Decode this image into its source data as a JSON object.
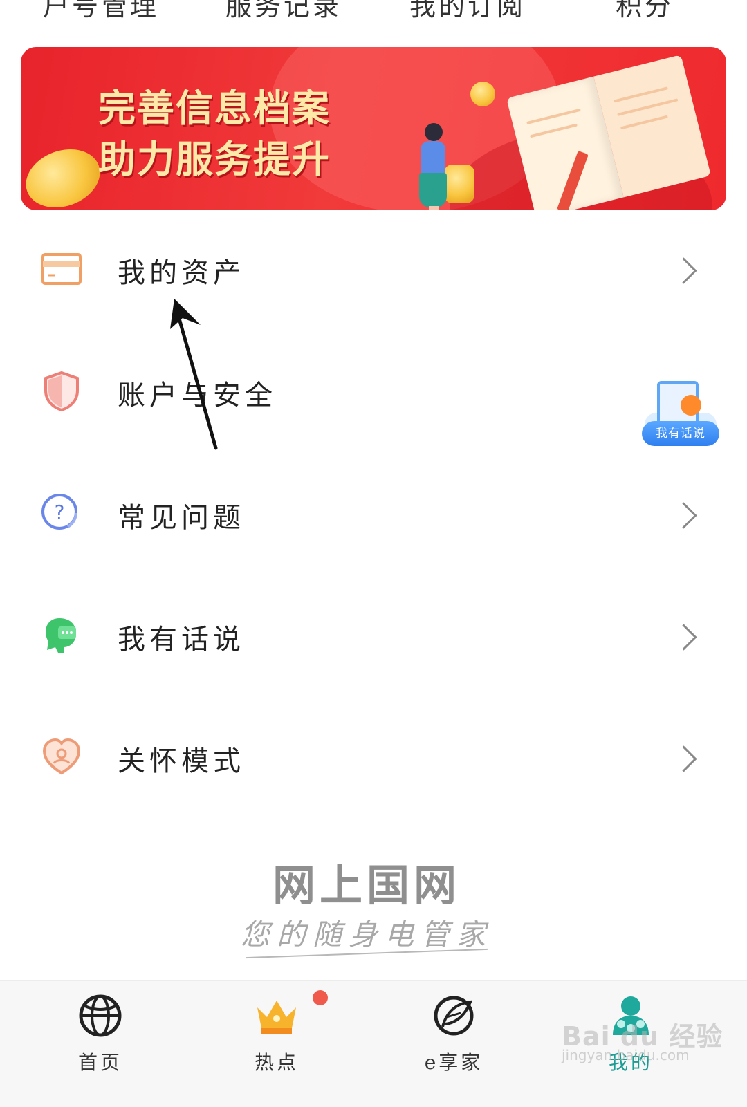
{
  "top_tabs": [
    "户号管理",
    "服务记录",
    "我的订阅",
    "积分"
  ],
  "banner": {
    "line1": "完善信息档案",
    "line2": "助力服务提升",
    "colors": {
      "background": "#ea2a2e",
      "text": "#ffe9a8"
    }
  },
  "menu": {
    "items": [
      {
        "label": "我的资产",
        "icon": "card-icon"
      },
      {
        "label": "账户与安全",
        "icon": "shield-icon"
      },
      {
        "label": "常见问题",
        "icon": "question-icon"
      },
      {
        "label": "我有话说",
        "icon": "chat-icon"
      },
      {
        "label": "关怀模式",
        "icon": "heart-icon"
      }
    ]
  },
  "floating_badge": {
    "label": "我有话说"
  },
  "brand": {
    "name": "网上国网",
    "slogan": "您的随身电管家"
  },
  "bottom_nav": {
    "items": [
      {
        "label": "首页",
        "icon": "globe-icon"
      },
      {
        "label": "热点",
        "icon": "crown-icon",
        "badge": true
      },
      {
        "label": "e享家",
        "icon": "leaf-icon"
      },
      {
        "label": "我的",
        "icon": "user-icon",
        "active": true
      }
    ],
    "active_color": "#1a9d92"
  },
  "watermark": {
    "text": "Bai du 经验",
    "sub": "jingyan.baidu.com"
  }
}
